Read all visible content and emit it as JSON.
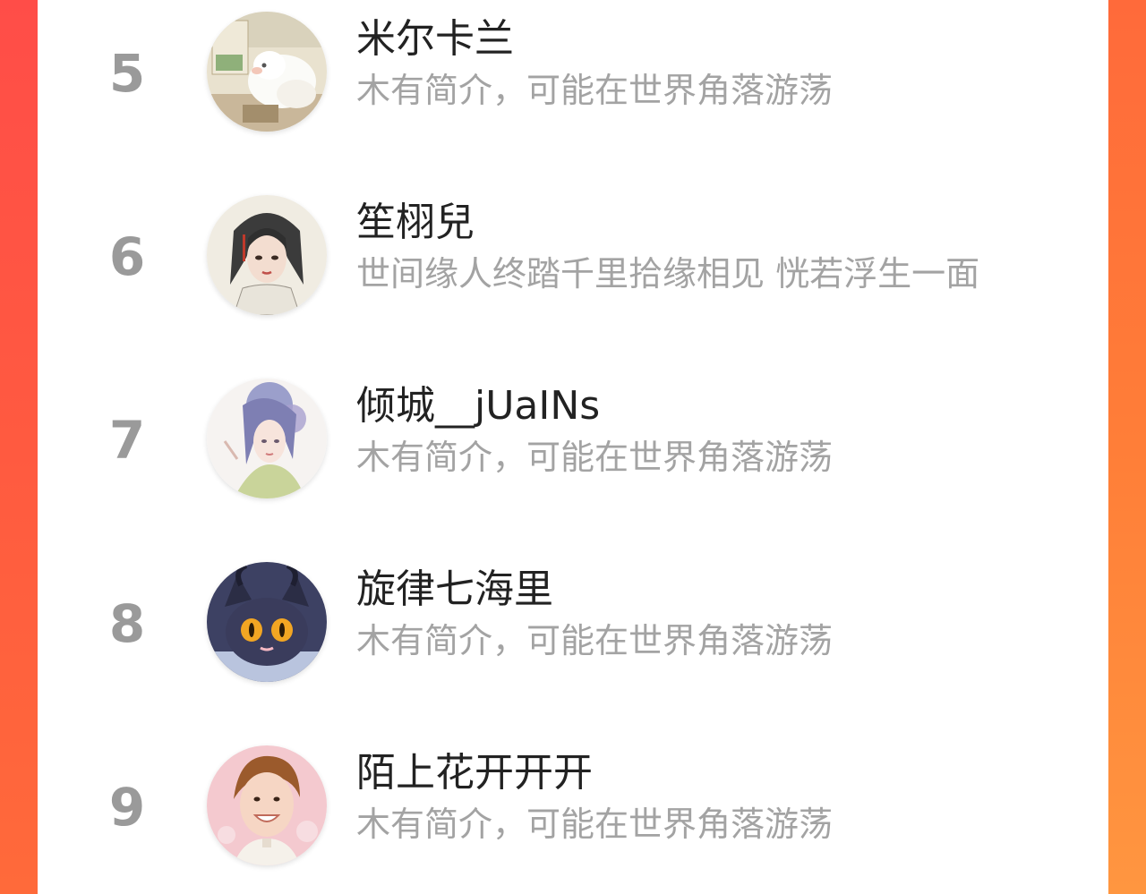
{
  "colors": {
    "rank": "#9a9a9a",
    "name": "#222222",
    "description": "#a3a3a3",
    "panel": "#ffffff",
    "frame_accent": "#ff6a3a"
  },
  "ranking": {
    "items": [
      {
        "rank": "5",
        "name": "米尔卡兰",
        "description": "木有简介，可能在世界角落游荡",
        "avatar_icon": "avatar-sheep-image"
      },
      {
        "rank": "6",
        "name": "笙栩兒",
        "description": "世间缘人终踏千里拾缘相见 恍若浮生一面",
        "avatar_icon": "avatar-ink-portrait-image"
      },
      {
        "rank": "7",
        "name": "倾城__jUaINs",
        "description": "木有简介，可能在世界角落游荡",
        "avatar_icon": "avatar-watercolor-girl-image"
      },
      {
        "rank": "8",
        "name": "旋律七海里",
        "description": "木有简介，可能在世界角落游荡",
        "avatar_icon": "avatar-dark-cat-image"
      },
      {
        "rank": "9",
        "name": "陌上花开开开",
        "description": "木有简介，可能在世界角落游荡",
        "avatar_icon": "avatar-smiling-boy-image"
      }
    ]
  }
}
